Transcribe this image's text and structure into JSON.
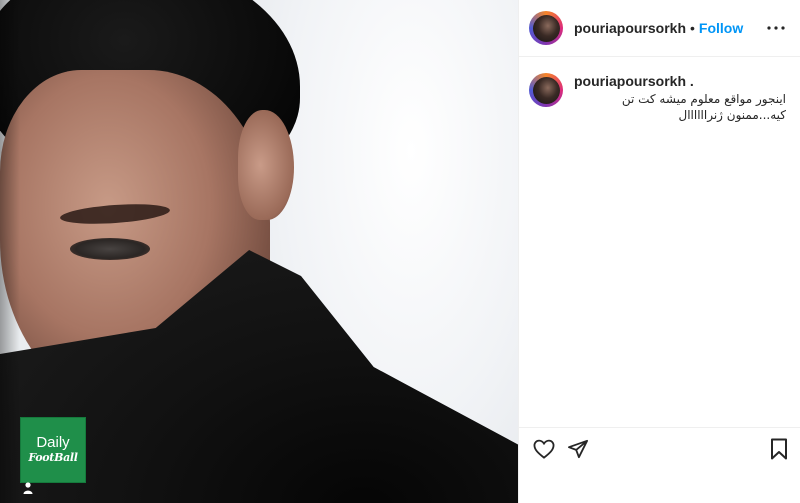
{
  "post": {
    "username": "pouriapoursorkh",
    "separator": "•",
    "follow_label": "Follow",
    "caption": {
      "username": "pouriapoursorkh .",
      "text": "اینجور مواقع معلوم میشه کت تن\nکیه...ممنون ژنراااااال"
    }
  },
  "watermark": {
    "line1": "Daily",
    "line2": "FootBall",
    "color": "#1f8f4a"
  },
  "icons": {
    "more": "more-options-icon",
    "like": "heart-icon",
    "share": "share-icon",
    "save": "bookmark-icon"
  },
  "colors": {
    "follow": "#0095f6",
    "text": "#262626",
    "divider": "#efefef"
  }
}
